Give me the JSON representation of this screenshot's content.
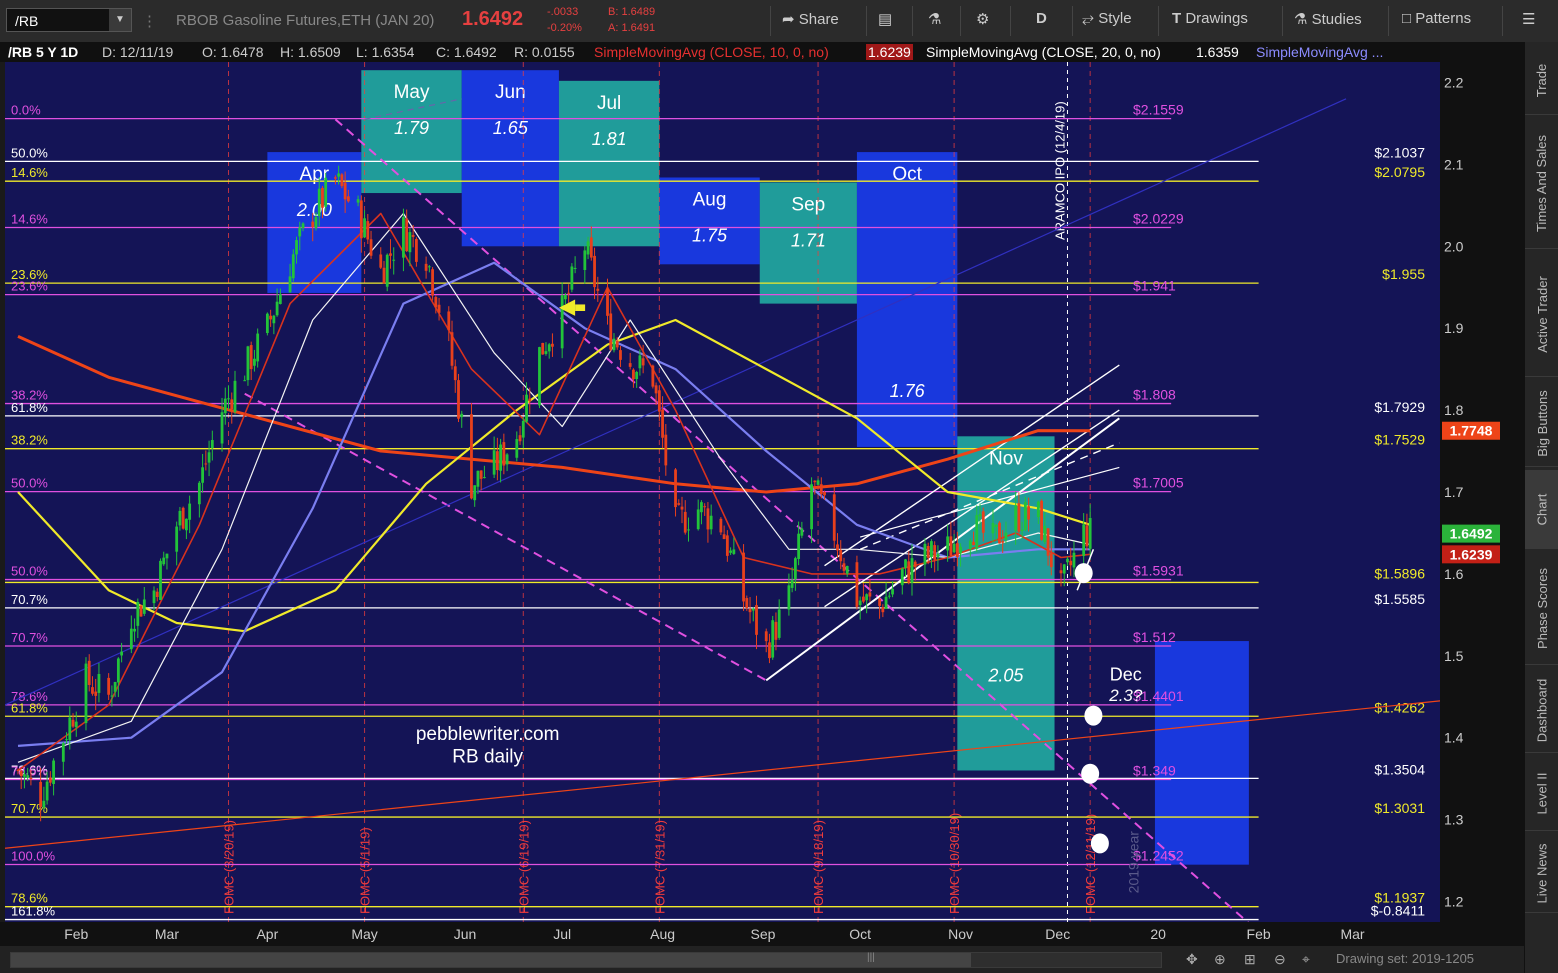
{
  "toolbar": {
    "symbol": "/RB",
    "description": "RBOB Gasoline Futures,ETH (JAN 20)",
    "last": "1.6492",
    "change": "-.0033",
    "change_pct": "-0.20%",
    "bid": "B: 1.6489",
    "ask": "A: 1.6491",
    "share_label": "Share",
    "aggregation": "D",
    "style_label": "Style",
    "drawings_label": "Drawings",
    "studies_label": "Studies",
    "patterns_label": "Patterns"
  },
  "info": {
    "title": "/RB 5 Y 1D",
    "date": "D: 12/11/19",
    "open": "O: 1.6478",
    "high": "H: 1.6509",
    "low": "L: 1.6354",
    "close": "C: 1.6492",
    "range": "R: 0.0155",
    "sma10_label": "SimpleMovingAvg (CLOSE, 10, 0, no)",
    "sma10_value": "1.6239",
    "sma20_label": "SimpleMovingAvg (CLOSE, 20, 0, no)",
    "sma20_value": "1.6359",
    "sma_more": "SimpleMovingAvg ..."
  },
  "status": {
    "drawing_set": "Drawing set: 2019-1205"
  },
  "right_tabs": [
    "Trade",
    "Times And Sales",
    "Active Trader",
    "Big Buttons",
    "Chart",
    "Phase Scores",
    "Dashboard",
    "Level II",
    "Live News"
  ],
  "colors": {
    "background": "#141456",
    "candle_up": "#22c33a",
    "candle_down": "#e8401c",
    "sma10": "#d8321e",
    "sma20": "#f4f4f4",
    "sma50": "#7a7ef0",
    "sma100": "#f0ea2a",
    "sma200": "#ee4418",
    "fib_magenta": "#e050e0",
    "fib_yellow": "#f0ea2a",
    "fomc": "#f03c3c",
    "month_teal": "#22a8a0",
    "month_blue": "#1a3ce8"
  },
  "chart_data": {
    "type": "candlestick",
    "ylim": [
      1.175,
      2.225
    ],
    "x_labels": [
      "Feb",
      "Mar",
      "Apr",
      "May",
      "Jun",
      "Jul",
      "Aug",
      "Sep",
      "Oct",
      "Nov",
      "Dec",
      "20",
      "Feb",
      "Mar"
    ],
    "y_ticks": [
      2.2,
      2.1,
      2.0,
      1.9,
      1.8,
      1.7,
      1.6,
      1.5,
      1.4,
      1.3,
      1.2
    ],
    "price_tags": [
      {
        "value": 1.7748,
        "label": "1.7748",
        "color": "#ee4418"
      },
      {
        "value": 1.6492,
        "label": "1.6492",
        "color": "#2bb33a"
      },
      {
        "value": 1.6239,
        "label": "1.6239",
        "color": "#c32016"
      }
    ],
    "close_path": [
      [
        "2019-01-14",
        1.36
      ],
      [
        "2019-01-21",
        1.33
      ],
      [
        "2019-01-28",
        1.4
      ],
      [
        "2019-02-04",
        1.47
      ],
      [
        "2019-02-11",
        1.45
      ],
      [
        "2019-02-18",
        1.55
      ],
      [
        "2019-02-25",
        1.58
      ],
      [
        "2019-03-04",
        1.66
      ],
      [
        "2019-03-11",
        1.71
      ],
      [
        "2019-03-18",
        1.8
      ],
      [
        "2019-03-25",
        1.85
      ],
      [
        "2019-04-01",
        1.9
      ],
      [
        "2019-04-08",
        1.98
      ],
      [
        "2019-04-15",
        2.04
      ],
      [
        "2019-04-22",
        2.08
      ],
      [
        "2019-04-29",
        2.04
      ],
      [
        "2019-05-06",
        1.97
      ],
      [
        "2019-05-13",
        2.02
      ],
      [
        "2019-05-20",
        1.99
      ],
      [
        "2019-05-27",
        1.88
      ],
      [
        "2019-06-03",
        1.71
      ],
      [
        "2019-06-10",
        1.73
      ],
      [
        "2019-06-17",
        1.77
      ],
      [
        "2019-06-24",
        1.87
      ],
      [
        "2019-07-01",
        1.92
      ],
      [
        "2019-07-08",
        2.0
      ],
      [
        "2019-07-15",
        1.9
      ],
      [
        "2019-07-22",
        1.86
      ],
      [
        "2019-07-29",
        1.84
      ],
      [
        "2019-08-05",
        1.66
      ],
      [
        "2019-08-12",
        1.68
      ],
      [
        "2019-08-19",
        1.66
      ],
      [
        "2019-08-26",
        1.57
      ],
      [
        "2019-09-02",
        1.51
      ],
      [
        "2019-09-09",
        1.57
      ],
      [
        "2019-09-16",
        1.71
      ],
      [
        "2019-09-23",
        1.65
      ],
      [
        "2019-09-30",
        1.57
      ],
      [
        "2019-10-07",
        1.56
      ],
      [
        "2019-10-14",
        1.6
      ],
      [
        "2019-10-21",
        1.62
      ],
      [
        "2019-10-28",
        1.63
      ],
      [
        "2019-11-04",
        1.66
      ],
      [
        "2019-11-11",
        1.64
      ],
      [
        "2019-11-18",
        1.67
      ],
      [
        "2019-11-25",
        1.67
      ],
      [
        "2019-12-02",
        1.58
      ],
      [
        "2019-12-09",
        1.65
      ]
    ],
    "sma_paths": {
      "sma10": [
        [
          "2019-01-14",
          1.36
        ],
        [
          "2019-02-11",
          1.44
        ],
        [
          "2019-03-11",
          1.66
        ],
        [
          "2019-04-08",
          1.93
        ],
        [
          "2019-05-06",
          2.04
        ],
        [
          "2019-06-03",
          1.85
        ],
        [
          "2019-06-24",
          1.77
        ],
        [
          "2019-07-15",
          1.95
        ],
        [
          "2019-08-05",
          1.8
        ],
        [
          "2019-08-26",
          1.62
        ],
        [
          "2019-09-16",
          1.6
        ],
        [
          "2019-10-07",
          1.6
        ],
        [
          "2019-10-28",
          1.62
        ],
        [
          "2019-11-18",
          1.65
        ],
        [
          "2019-12-02",
          1.62
        ],
        [
          "2019-12-11",
          1.6239
        ]
      ],
      "sma20": [
        [
          "2019-01-14",
          1.37
        ],
        [
          "2019-02-18",
          1.42
        ],
        [
          "2019-03-18",
          1.63
        ],
        [
          "2019-04-15",
          1.91
        ],
        [
          "2019-05-13",
          2.04
        ],
        [
          "2019-06-10",
          1.87
        ],
        [
          "2019-07-01",
          1.78
        ],
        [
          "2019-07-22",
          1.91
        ],
        [
          "2019-08-19",
          1.74
        ],
        [
          "2019-09-09",
          1.63
        ],
        [
          "2019-09-30",
          1.63
        ],
        [
          "2019-10-28",
          1.62
        ],
        [
          "2019-11-25",
          1.65
        ],
        [
          "2019-12-11",
          1.6359
        ]
      ],
      "sma50": [
        [
          "2019-01-14",
          1.39
        ],
        [
          "2019-02-18",
          1.4
        ],
        [
          "2019-03-18",
          1.48
        ],
        [
          "2019-04-15",
          1.68
        ],
        [
          "2019-05-13",
          1.93
        ],
        [
          "2019-06-10",
          1.98
        ],
        [
          "2019-07-08",
          1.9
        ],
        [
          "2019-08-05",
          1.85
        ],
        [
          "2019-09-02",
          1.75
        ],
        [
          "2019-09-30",
          1.66
        ],
        [
          "2019-10-28",
          1.62
        ],
        [
          "2019-11-25",
          1.63
        ],
        [
          "2019-12-11",
          1.63
        ]
      ],
      "sma100": [
        [
          "2019-01-14",
          1.7
        ],
        [
          "2019-02-11",
          1.58
        ],
        [
          "2019-03-04",
          1.54
        ],
        [
          "2019-03-25",
          1.53
        ],
        [
          "2019-04-22",
          1.58
        ],
        [
          "2019-05-20",
          1.71
        ],
        [
          "2019-06-17",
          1.8
        ],
        [
          "2019-07-15",
          1.88
        ],
        [
          "2019-08-05",
          1.91
        ],
        [
          "2019-09-02",
          1.85
        ],
        [
          "2019-09-30",
          1.79
        ],
        [
          "2019-10-28",
          1.7
        ],
        [
          "2019-11-25",
          1.68
        ],
        [
          "2019-12-11",
          1.66
        ]
      ],
      "sma200": [
        [
          "2019-01-14",
          1.89
        ],
        [
          "2019-02-11",
          1.84
        ],
        [
          "2019-03-11",
          1.81
        ],
        [
          "2019-04-08",
          1.78
        ],
        [
          "2019-05-06",
          1.75
        ],
        [
          "2019-06-03",
          1.74
        ],
        [
          "2019-07-01",
          1.73
        ],
        [
          "2019-08-05",
          1.71
        ],
        [
          "2019-09-02",
          1.7
        ],
        [
          "2019-09-30",
          1.71
        ],
        [
          "2019-10-28",
          1.74
        ],
        [
          "2019-11-25",
          1.775
        ],
        [
          "2019-12-11",
          1.7748
        ]
      ]
    },
    "fib_levels": [
      {
        "value": 2.1559,
        "left": "0.0%",
        "price": "$2.1559",
        "color": "#e050e0",
        "x_from": "2019-01-10",
        "x_to": "2020-01-05",
        "right": ""
      },
      {
        "value": 2.1037,
        "left": "50.0%",
        "price": "",
        "right": "$2.1037",
        "color": "#ffffff",
        "x_from": "2019-01-10",
        "x_to": "2020-02-01"
      },
      {
        "value": 2.0795,
        "left": "14.6%",
        "price": "",
        "right": "$2.0795",
        "color": "#f0ea2a",
        "x_from": "2019-01-10",
        "x_to": "2020-02-01"
      },
      {
        "value": 2.0229,
        "left": "14.6%",
        "price": "$2.0229",
        "right": "",
        "color": "#e050e0",
        "x_from": "2019-01-10",
        "x_to": "2020-01-05"
      },
      {
        "value": 1.955,
        "left": "23.6%",
        "price": "",
        "right": "$1.955",
        "color": "#f0ea2a",
        "x_from": "2019-01-10",
        "x_to": "2020-02-01"
      },
      {
        "value": 1.941,
        "left": "23.6%",
        "price": "$1.941",
        "right": "",
        "color": "#e050e0",
        "x_from": "2019-01-10",
        "x_to": "2020-01-05"
      },
      {
        "value": 1.808,
        "left": "38.2%",
        "price": "$1.808",
        "right": "",
        "color": "#e050e0",
        "x_from": "2019-01-10",
        "x_to": "2020-01-05"
      },
      {
        "value": 1.7929,
        "left": "61.8%",
        "price": "",
        "right": "$1.7929",
        "color": "#ffffff",
        "x_from": "2019-01-10",
        "x_to": "2020-02-01"
      },
      {
        "value": 1.7529,
        "left": "38.2%",
        "price": "",
        "right": "$1.7529",
        "color": "#f0ea2a",
        "x_from": "2019-01-10",
        "x_to": "2020-02-01"
      },
      {
        "value": 1.7005,
        "left": "50.0%",
        "price": "$1.7005",
        "right": "",
        "color": "#e050e0",
        "x_from": "2019-01-10",
        "x_to": "2020-01-05"
      },
      {
        "value": 1.5931,
        "left": "50.0%",
        "price": "$1.5931",
        "right": "",
        "color": "#e050e0",
        "x_from": "2019-01-10",
        "x_to": "2020-01-05"
      },
      {
        "value": 1.5896,
        "left": "",
        "price": "",
        "right": "$1.5896",
        "color": "#f0ea2a",
        "x_from": "2019-01-10",
        "x_to": "2020-02-01"
      },
      {
        "value": 1.5585,
        "left": "70.7%",
        "price": "",
        "right": "$1.5585",
        "color": "#ffffff",
        "x_from": "2019-01-10",
        "x_to": "2020-02-01"
      },
      {
        "value": 1.512,
        "left": "70.7%",
        "price": "$1.512",
        "right": "",
        "color": "#e050e0",
        "x_from": "2019-01-10",
        "x_to": "2020-01-05"
      },
      {
        "value": 1.4401,
        "left": "78.6%",
        "price": "$1.4401",
        "right": "",
        "color": "#e050e0",
        "x_from": "2019-01-10",
        "x_to": "2020-01-05"
      },
      {
        "value": 1.4262,
        "left": "61.8%",
        "price": "",
        "right": "$1.4262",
        "color": "#f0ea2a",
        "x_from": "2019-01-10",
        "x_to": "2020-02-01"
      },
      {
        "value": 1.3504,
        "left": "78.6%",
        "price": "",
        "right": "$1.3504",
        "color": "#ffffff",
        "x_from": "2019-01-10",
        "x_to": "2020-02-01"
      },
      {
        "value": 1.349,
        "left": "78.6%",
        "price": "$1.349",
        "right": "",
        "color": "#e050e0",
        "x_from": "2019-01-10",
        "x_to": "2020-01-05"
      },
      {
        "value": 1.3031,
        "left": "70.7%",
        "price": "",
        "right": "$1.3031",
        "color": "#f0ea2a",
        "x_from": "2019-01-10",
        "x_to": "2020-02-01"
      },
      {
        "value": 1.2452,
        "left": "100.0%",
        "price": "$1.2452",
        "right": "",
        "color": "#e050e0",
        "x_from": "2019-01-10",
        "x_to": "2020-01-05"
      },
      {
        "value": 1.1937,
        "left": "78.6%",
        "price": "",
        "right": "$1.1937",
        "color": "#f0ea2a",
        "x_from": "2019-01-10",
        "x_to": "2020-02-01"
      },
      {
        "value": 1.178,
        "left": "161.8%",
        "price": "",
        "right": "$-0.8411",
        "color": "#ffffff",
        "x_from": "2019-01-10",
        "x_to": "2020-02-01"
      }
    ],
    "month_boxes": [
      {
        "label": "Apr",
        "value": "2.00",
        "x0": "2019-04-01",
        "x1": "2019-04-30",
        "y_top": 2.115,
        "y_bot": 1.943,
        "color": "#1a3ce8"
      },
      {
        "label": "May",
        "value": "1.79",
        "x0": "2019-04-30",
        "x1": "2019-05-31",
        "y_top": 2.215,
        "y_bot": 2.065,
        "color": "#22a8a0"
      },
      {
        "label": "Jun",
        "value": "1.65",
        "x0": "2019-05-31",
        "x1": "2019-06-30",
        "y_top": 2.215,
        "y_bot": 2.0,
        "color": "#1a3ce8"
      },
      {
        "label": "Jul",
        "value": "1.81",
        "x0": "2019-06-30",
        "x1": "2019-07-31",
        "y_top": 2.202,
        "y_bot": 2.0,
        "color": "#22a8a0"
      },
      {
        "label": "Aug",
        "value": "1.75",
        "x0": "2019-07-31",
        "x1": "2019-08-31",
        "y_top": 2.084,
        "y_bot": 1.978,
        "color": "#1a3ce8"
      },
      {
        "label": "Sep",
        "value": "1.71",
        "x0": "2019-08-31",
        "x1": "2019-09-30",
        "y_top": 2.078,
        "y_bot": 1.93,
        "color": "#22a8a0"
      },
      {
        "label": "Oct",
        "value": "1.76",
        "x0": "2019-09-30",
        "x1": "2019-10-31",
        "y_top": 2.115,
        "y_bot": 1.755,
        "color": "#1a3ce8"
      },
      {
        "label": "Nov",
        "value": "2.05",
        "x0": "2019-10-31",
        "x1": "2019-11-30",
        "y_top": 1.768,
        "y_bot": 1.36,
        "color": "#22a8a0"
      },
      {
        "label": "",
        "value": "",
        "x0": "2019-12-31",
        "x1": "2020-01-29",
        "y_top": 1.518,
        "y_bot": 1.245,
        "color": "#1a3ce8"
      }
    ],
    "fomc": [
      {
        "date": "2019-03-20",
        "label": "FOMC (3/20/19)"
      },
      {
        "date": "2019-05-01",
        "label": "FOMC (5/1/19)"
      },
      {
        "date": "2019-06-19",
        "label": "FOMC (6/19/19)"
      },
      {
        "date": "2019-07-31",
        "label": "FOMC (7/31/19)"
      },
      {
        "date": "2019-09-18",
        "label": "FOMC (9/18/19)"
      },
      {
        "date": "2019-10-30",
        "label": "FOMC (10/30/19)"
      },
      {
        "date": "2019-12-11",
        "label": "FOMC (12/11/19)"
      }
    ],
    "event": {
      "date": "2019-12-04",
      "label": "ARAMCO IPO (12/4/19)"
    },
    "annotations": {
      "dec_label": "Dec",
      "dec_value": "2.3?",
      "site": "pebblewriter.com",
      "chart_name": "RB daily",
      "year_watermark": "2019 year"
    },
    "targets": [
      {
        "date": "2019-12-09",
        "value": 1.601
      },
      {
        "date": "2019-12-12",
        "value": 1.427
      },
      {
        "date": "2019-12-11",
        "value": 1.356
      },
      {
        "date": "2019-12-14",
        "value": 1.271
      }
    ]
  }
}
